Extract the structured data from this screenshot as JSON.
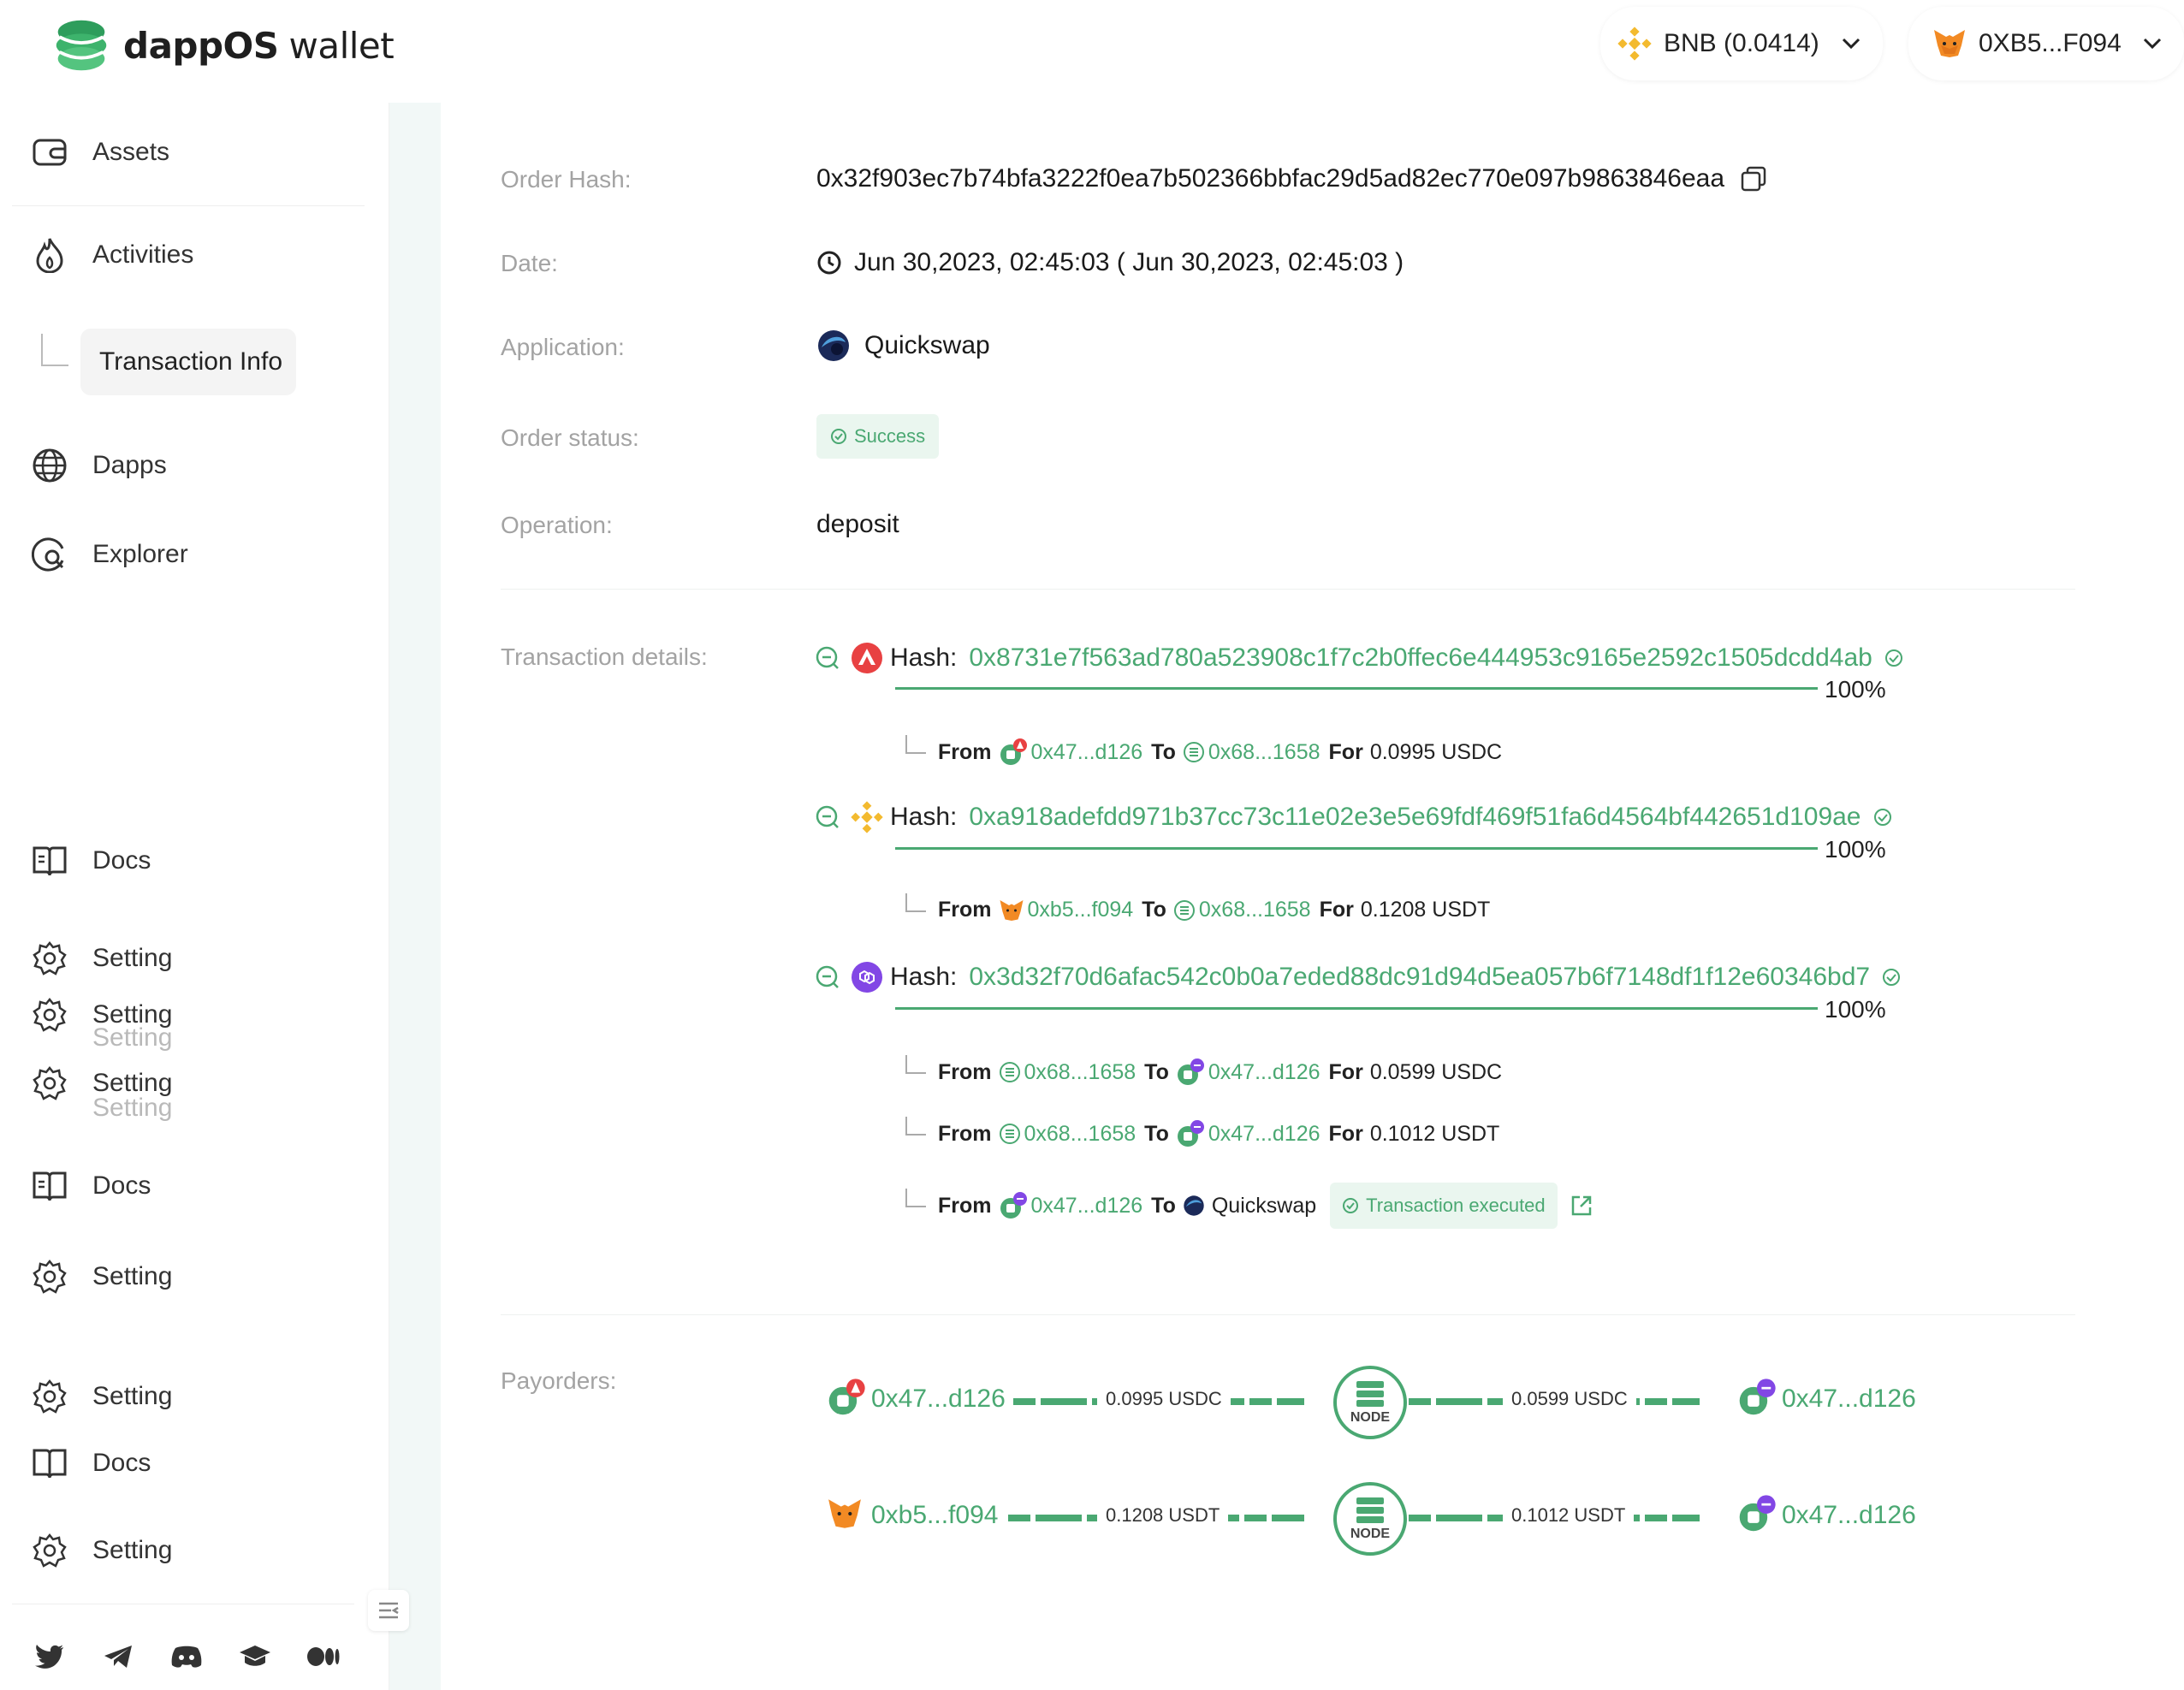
{
  "header": {
    "logo_brand": "dappOS",
    "logo_suffix": "wallet",
    "chain": {
      "label": "BNB (0.0414)",
      "icon": "bnb-icon"
    },
    "wallet": {
      "label": "0XB5...F094",
      "icon": "metamask-fox-icon"
    }
  },
  "sidebar": {
    "assets": "Assets",
    "activities": "Activities",
    "transaction_info": "Transaction Info",
    "dapps": "Dapps",
    "explorer": "Explorer",
    "docs": "Docs",
    "setting": "Setting"
  },
  "order": {
    "hash_label": "Order Hash:",
    "hash": "0x32f903ec7b74bfa3222f0ea7b502366bbfac29d5ad82ec770e097b9863846eaa",
    "date_label": "Date:",
    "date": "Jun 30,2023, 02:45:03 ( Jun 30,2023, 02:45:03 )",
    "application_label": "Application:",
    "application": "Quickswap",
    "status_label": "Order status:",
    "status": "Success",
    "operation_label": "Operation:",
    "operation": "deposit"
  },
  "details": {
    "label": "Transaction details:",
    "hash_word": "Hash:",
    "from_word": "From",
    "to_word": "To",
    "for_word": "For",
    "txs": [
      {
        "chain_icon": "avalanche-icon",
        "hash": "0x8731e7f563ad780a523908c1f7c2b0ffec6e444953c9165e2592c1505dcdd4ab",
        "progress": "100%",
        "transfers": [
          {
            "from": "0x47...d126",
            "to": "0x68...1658",
            "amount": "0.0995 USDC"
          }
        ]
      },
      {
        "chain_icon": "bnb-icon",
        "hash": "0xa918adefdd971b37cc73c11e02e3e5e69fdf469f51fa6d4564bf442651d109ae",
        "progress": "100%",
        "transfers": [
          {
            "from": "0xb5...f094",
            "to": "0x68...1658",
            "amount": "0.1208 USDT"
          }
        ]
      },
      {
        "chain_icon": "polygon-icon",
        "hash": "0x3d32f70d6afac542c0b0a7eded88dc91d94d5ea057b6f7148df1f12e60346bd7",
        "progress": "100%",
        "transfers": [
          {
            "from": "0x68...1658",
            "to": "0x47...d126",
            "amount": "0.0599 USDC"
          },
          {
            "from": "0x68...1658",
            "to": "0x47...d126",
            "amount": "0.1012 USDT"
          },
          {
            "from": "0x47...d126",
            "to": "Quickswap",
            "status": "Transaction executed"
          }
        ]
      }
    ]
  },
  "payorders": {
    "label": "Payorders:",
    "node_label": "NODE",
    "rows": [
      {
        "from": "0x47...d126",
        "in_amount": "0.0995 USDC",
        "out_amount": "0.0599 USDC",
        "to": "0x47...d126"
      },
      {
        "from": "0xb5...f094",
        "in_amount": "0.1208 USDT",
        "out_amount": "0.1012 USDT",
        "to": "0x47...d126"
      }
    ]
  },
  "colors": {
    "accent": "#4aa872",
    "label_gray": "#a3a3a3",
    "strip": "#f2f8f7"
  }
}
